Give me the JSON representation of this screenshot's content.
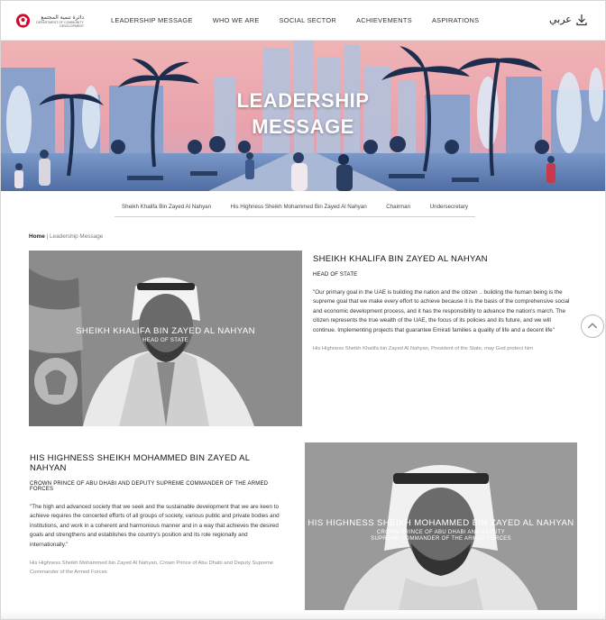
{
  "header": {
    "logo_arabic": "دائرة تنمية المجتمع",
    "logo_english": "DEPARTMENT OF COMMUNITY DEVELOPMENT",
    "nav": [
      "LEADERSHIP MESSAGE",
      "WHO WE ARE",
      "SOCIAL SECTOR",
      "ACHIEVEMENTS",
      "ASPIRATIONS"
    ],
    "language": "عربي",
    "download_icon": "download-icon"
  },
  "hero": {
    "title_line1": "LEADERSHIP",
    "title_line2": "MESSAGE"
  },
  "subtabs": [
    "Sheikh Khalifa Bin Zayed Al Nahyan",
    "His Highness Sheikh Mohammed Bin Zayed Al Nahyan",
    "Chairman",
    "Undersecretary"
  ],
  "breadcrumb": {
    "home": "Home",
    "separator": "|",
    "current": "Leadership Message"
  },
  "leaders": [
    {
      "photo_name": "SHEIKH KHALIFA BIN ZAYED AL NAHYAN",
      "photo_role": "HEAD OF STATE",
      "name": "SHEIKH KHALIFA BIN ZAYED AL NAHYAN",
      "role": "HEAD OF STATE",
      "quote": "\"Our primary goal in the UAE is building the nation and the citizen .. building the human being is the supreme goal that we make every effort to achieve because it is the basis of the comprehensive social and economic development process, and it has the responsibility to advance the nation's march. The citizen represents the true wealth of the UAE, the focus of its policies and its future, and we will continue. Implementing projects that guarantee Emirati families a quality of life and a decent life\"",
      "source": "His Highness Sheikh Khalifa bin Zayed Al Nahyan, President of the State, may God protect him"
    },
    {
      "photo_name": "HIS HIGHNESS SHEIKH MOHAMMED BIN ZAYED AL NAHYAN",
      "photo_role_line1": "CROWN PRINCE OF ABU DHABI AND DEPUTY",
      "photo_role_line2": "SUPREME COMMANDER OF THE ARMED FORCES",
      "name": "HIS HIGHNESS SHEIKH MOHAMMED BIN ZAYED AL NAHYAN",
      "role": "CROWN PRINCE OF ABU DHABI AND DEPUTY SUPREME COMMANDER OF THE ARMED FORCES",
      "quote": "\"The high and advanced society that we seek and the sustainable development that we are keen to achieve requires the concerted efforts of all groups of society, various public and private bodies and institutions, and work in a coherent and harmonious manner and in a way that achieves the desired goals and strengthens and establishes the country's position and its role regionally and internationally.\"",
      "source": "His Highness Sheikh Mohammed bin Zayed Al Nahyan, Crown Prince of Abu Dhabi and Deputy Supreme Commander of the Armed Forces"
    }
  ],
  "colors": {
    "hero_sky": "#e8a0a8",
    "hero_blue": "#5b7fb8",
    "hero_ground": "#6f8fc4",
    "photo_gray": "#8f8f8f"
  }
}
